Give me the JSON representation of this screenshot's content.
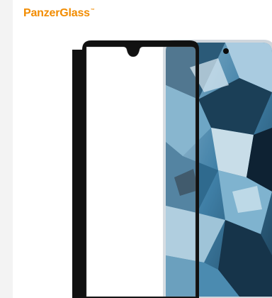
{
  "brand": {
    "name": "PanzerGlass",
    "trademark": "™",
    "color": "#f28c00"
  },
  "product_image": {
    "description_icon": "screen-protector-with-phone-icon",
    "frame_color": "#111111",
    "wallpaper_palette": [
      "#1b3f57",
      "#3f7fa6",
      "#7fb3cf",
      "#c8dde8",
      "#0e2233"
    ]
  }
}
